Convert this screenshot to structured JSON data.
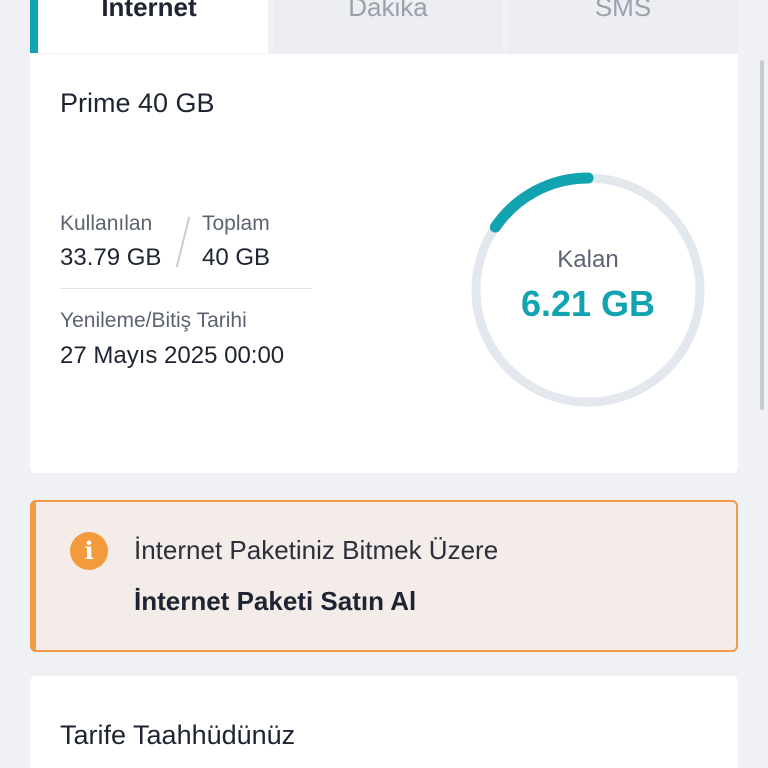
{
  "tabs": [
    {
      "label": "İnternet",
      "active": true
    },
    {
      "label": "Dakika",
      "active": false
    },
    {
      "label": "SMS",
      "active": false
    }
  ],
  "package": {
    "title": "Prime 40 GB",
    "used_label": "Kullanılan",
    "used_value": "33.79 GB",
    "total_label": "Toplam",
    "total_value": "40 GB",
    "renewal_label": "Yenileme/Bitiş Tarihi",
    "renewal_value": "27 Mayıs 2025 00:00",
    "remaining_label": "Kalan",
    "remaining_value": "6.21 GB",
    "remaining_fraction": 0.155
  },
  "warning": {
    "message": "İnternet Paketiniz Bitmek Üzere",
    "action": "İnternet Paketi Satın Al"
  },
  "commitment": {
    "title": "Tarife Taahhüdünüz"
  },
  "colors": {
    "accent": "#12a3b0",
    "ring_track": "#e3e7ee",
    "warning": "#f49a42"
  }
}
